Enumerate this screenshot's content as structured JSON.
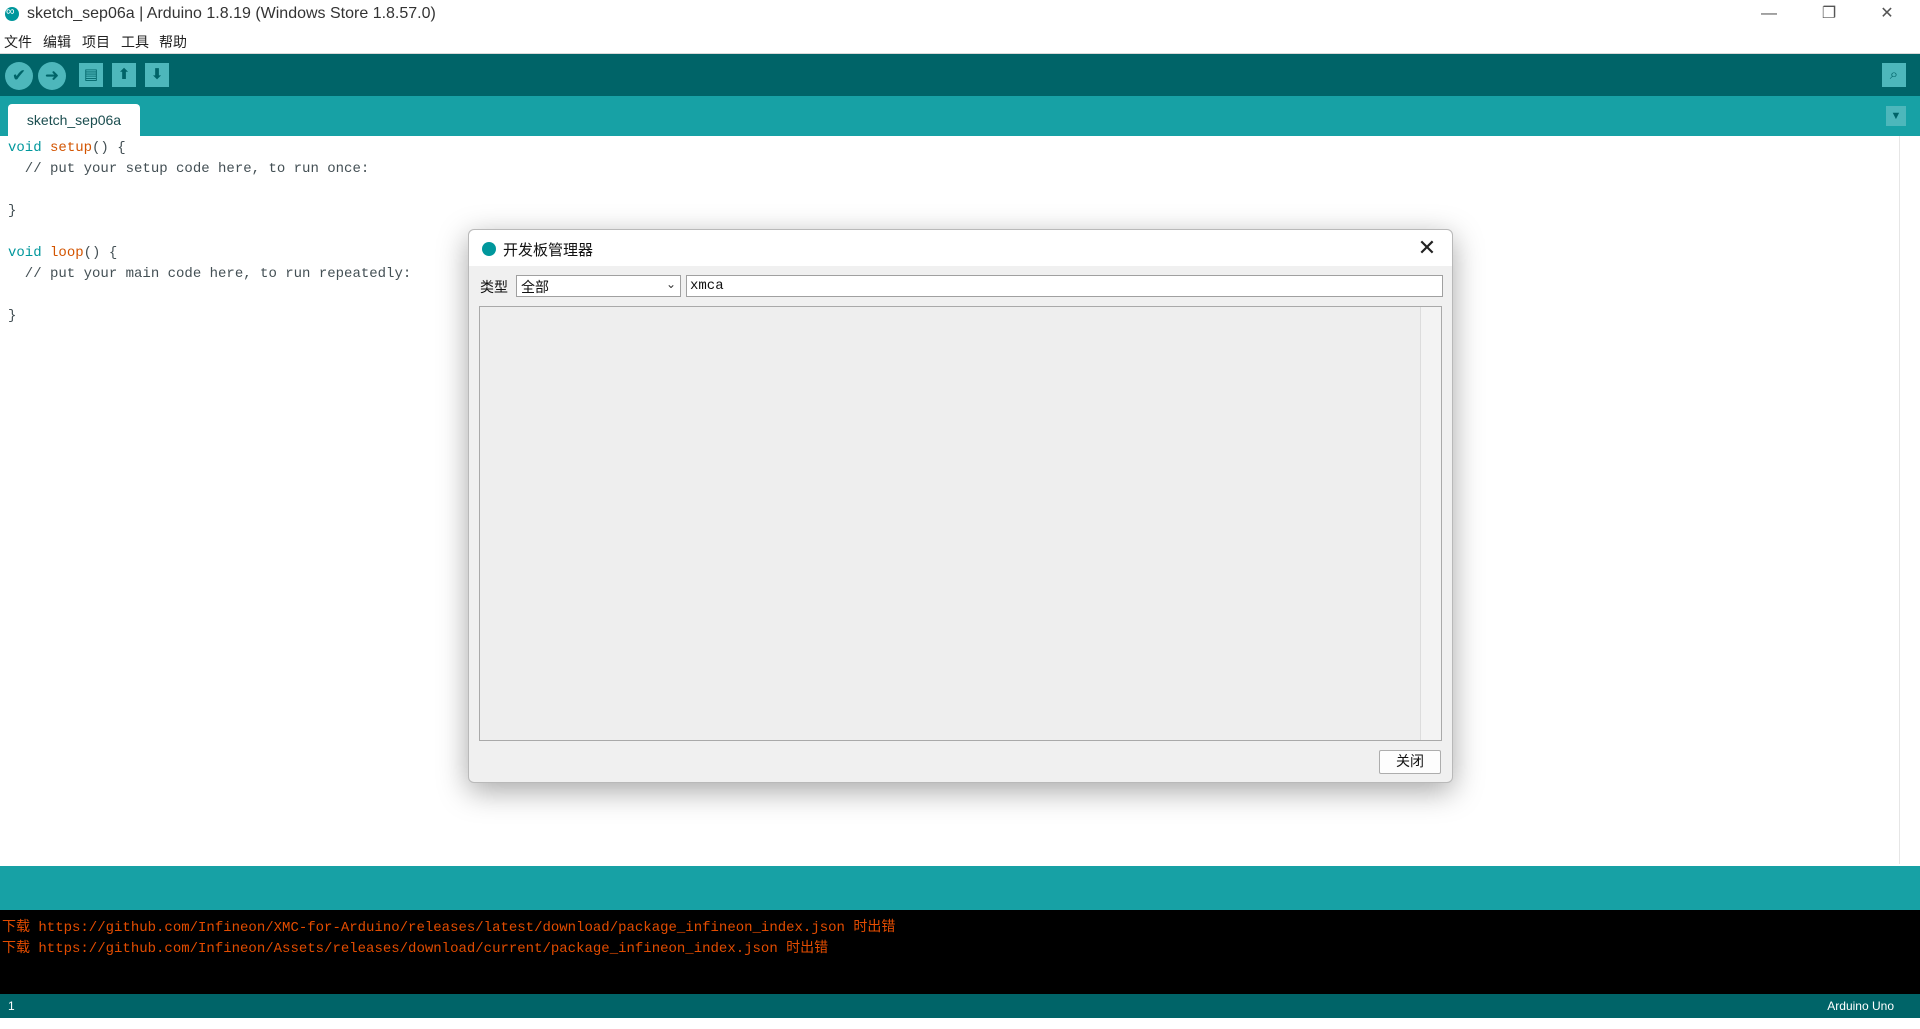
{
  "window": {
    "title": "sketch_sep06a | Arduino 1.8.19 (Windows Store 1.8.57.0)",
    "controls": {
      "minimize": "—",
      "restore": "❐",
      "close": "✕"
    }
  },
  "menu": [
    "文件",
    "编辑",
    "项目",
    "工具",
    "帮助"
  ],
  "toolbar": {
    "verify_icon": "✔",
    "upload_icon": "➜",
    "new_icon": "▤",
    "open_icon": "⬆",
    "save_icon": "⬇",
    "serial_icon": "⌕"
  },
  "tabs": [
    {
      "label": "sketch_sep06a"
    }
  ],
  "tab_menu_icon": "▼",
  "editor": {
    "line1_kw": "void",
    "line1_fn": "setup",
    "line1_rest": "() {",
    "line2": "  // put your setup code here, to run once:",
    "line4": "}",
    "line6_kw": "void",
    "line6_fn": "loop",
    "line6_rest": "() {",
    "line7": "  // put your main code here, to run repeatedly:",
    "line9": "}"
  },
  "console": {
    "lines": [
      "下载 https://github.com/Infineon/XMC-for-Arduino/releases/latest/download/package_infineon_index.json 时出错",
      "下载 https://github.com/Infineon/Assets/releases/download/current/package_infineon_index.json 时出错"
    ]
  },
  "status": {
    "line_number": "1",
    "board": "Arduino Uno"
  },
  "dialog": {
    "title": "开发板管理器",
    "close_icon": "✕",
    "type_label": "类型",
    "type_value": "全部",
    "type_chevron": "⌄",
    "filter_value": "xmca",
    "close_button": "关闭"
  },
  "colors": {
    "teal_dark": "#006468",
    "teal": "#17a1a5",
    "accent": "#00979c",
    "console_error": "#e34c00"
  }
}
